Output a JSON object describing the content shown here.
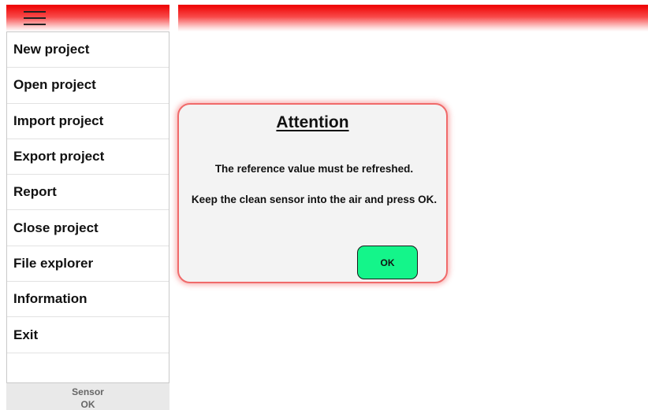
{
  "header": {
    "menu_icon": "hamburger-menu-icon",
    "accent_color": "#ee0000"
  },
  "sidebar": {
    "items": [
      {
        "label": "New project"
      },
      {
        "label": "Open project"
      },
      {
        "label": "Import project"
      },
      {
        "label": "Export project"
      },
      {
        "label": "Report"
      },
      {
        "label": "Close project"
      },
      {
        "label": "File explorer"
      },
      {
        "label": "Information"
      },
      {
        "label": "Exit"
      }
    ],
    "status": {
      "title": "Sensor",
      "value": "OK"
    }
  },
  "dialog": {
    "title": "Attention",
    "message_line1": "The reference value must be refreshed.",
    "message_line2": "Keep the clean sensor into the air and press OK.",
    "ok_label": "OK",
    "ok_color": "#14f58a",
    "border_color": "#f06a6a"
  }
}
